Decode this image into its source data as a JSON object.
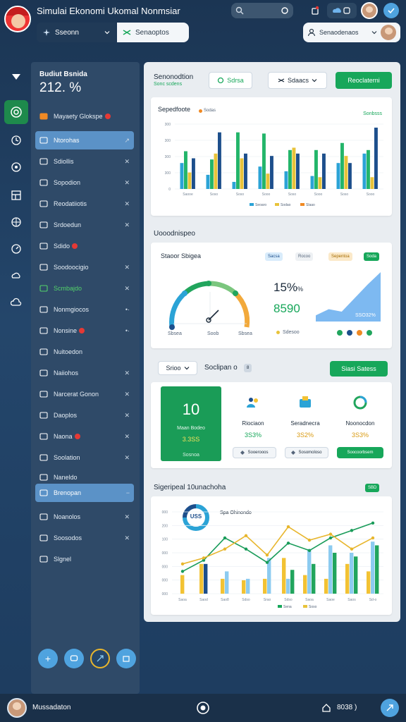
{
  "app": {
    "title": "Simulai Ekonomi Ukomal Nonmsiar",
    "search_placeholder": "",
    "user_name": "Mussadaton",
    "bottom_right_label": "8038 )"
  },
  "subtoolbar": {
    "left_label": "Sseonn",
    "mid_label": "Senaoptos",
    "right_label": "Senaodenaos"
  },
  "rail": {
    "items": [
      "home-icon",
      "target-icon",
      "clock-icon",
      "compass-icon",
      "grid-icon",
      "globe-icon",
      "gauge-icon",
      "cloud-shield-icon",
      "cloud-icon"
    ]
  },
  "sidebar": {
    "head_title": "Budiut Bsnida",
    "head_value": "212. %",
    "items": [
      {
        "label": "Mayaety Glokspe",
        "badge": true,
        "chev": "",
        "state": ""
      },
      {
        "label": "Ntorohas",
        "badge": false,
        "chev": "↗",
        "state": "active"
      },
      {
        "label": "Sdiollis",
        "badge": false,
        "chev": "✕",
        "state": ""
      },
      {
        "label": "Sopodion",
        "badge": false,
        "chev": "✕",
        "state": ""
      },
      {
        "label": "Reodatiiotis",
        "badge": false,
        "chev": "✕",
        "state": ""
      },
      {
        "label": "Srdoedun",
        "badge": false,
        "chev": "✕",
        "state": ""
      },
      {
        "label": "Sdido",
        "badge": true,
        "chev": "",
        "state": ""
      },
      {
        "label": "Soodoocigio",
        "badge": false,
        "chev": "✕",
        "state": ""
      },
      {
        "label": "Scmbajdo",
        "badge": false,
        "chev": "✕",
        "state": "green"
      },
      {
        "label": "Nonmgiocos",
        "badge": false,
        "chev": "•·",
        "state": ""
      },
      {
        "label": "Nonsine",
        "badge": true,
        "chev": "•·",
        "state": ""
      },
      {
        "label": "Nuitoedon",
        "badge": false,
        "chev": "",
        "state": ""
      },
      {
        "label": "Naiiohos",
        "badge": false,
        "chev": "✕",
        "state": ""
      },
      {
        "label": "Narcerat Gonon",
        "badge": false,
        "chev": "✕",
        "state": ""
      },
      {
        "label": "Daoplos",
        "badge": false,
        "chev": "✕",
        "state": ""
      },
      {
        "label": "Naona",
        "badge": true,
        "chev": "✕",
        "state": ""
      },
      {
        "label": "Soolation",
        "badge": false,
        "chev": "✕",
        "state": ""
      },
      {
        "label": "Naneldo",
        "badge": false,
        "chev": "",
        "state": ""
      },
      {
        "label": "Brenopan",
        "badge": false,
        "chev": "−",
        "state": "active"
      },
      {
        "label": "Noanolos",
        "badge": false,
        "chev": "✕",
        "state": ""
      },
      {
        "label": "Soosodos",
        "badge": false,
        "chev": "✕",
        "state": ""
      },
      {
        "label": "Slgnel",
        "badge": false,
        "chev": "",
        "state": ""
      }
    ]
  },
  "main": {
    "section1": {
      "title": "Senonodtion",
      "subtitle": "Sonc scdens",
      "btn_secondary": "Sdrsa",
      "dropdown": "Sdaacs",
      "btn_primary": "Reoclaterni"
    },
    "chart1": {
      "title": "Sepedfoote",
      "legend": "Sodas",
      "corner": "Sonbsss",
      "footer_legend": [
        "Seoaro",
        "Sodao",
        "Slaao"
      ]
    },
    "section2": {
      "title": "Uooodnispeo"
    },
    "gauge_card": {
      "title": "Staoor Sbigea",
      "tags": [
        "Sacsa",
        "Rocoo",
        "Sepentoa",
        "Soda"
      ],
      "percent": "15%",
      "percent_suffix": "%",
      "value": "8590",
      "area_label": "SSO32%",
      "legend_text": "Sdesoo",
      "gauge_left_label": "Sbsea",
      "gauge_right_label": "Sbsea",
      "gauge_mid_label": "Soob"
    },
    "section3": {
      "dropdown": "Srioo",
      "title": "Soclipan o",
      "badge": "8",
      "btn_primary": "Siasi Satess"
    },
    "kpis": {
      "main_value": "10",
      "main_label": "Maan Bodeo",
      "main_sub": "3.3SS",
      "main_foot": "Sosnoa",
      "items": [
        {
          "title": "Riociaon",
          "value": "3S3%",
          "btn": "Sooerooos"
        },
        {
          "title": "Seradnecra",
          "value": "3S2%",
          "btn": "Sosomoloso"
        },
        {
          "title": "Noonocdon",
          "value": "3S3%",
          "btn": "Soocoorbsem"
        }
      ]
    },
    "chart2": {
      "title": "Sigeripeal 10unachoha",
      "badge": "SBD",
      "donut_value": "USS",
      "inset_title": "Spa Ohinondo",
      "footer_legend": [
        "Sena",
        "Soso"
      ]
    }
  },
  "chart_data": [
    {
      "type": "bar",
      "title": "Sepedfoote",
      "categories": [
        "Saooe",
        "Soso",
        "Soso",
        "Sooo",
        "Soso",
        "Sooo",
        "Soso",
        "Sooo"
      ],
      "yticks": [
        "300",
        "300",
        "300",
        "300",
        "0"
      ],
      "series": [
        {
          "values": [
            44,
            24,
            12,
            38,
            30,
            22,
            44,
            60
          ],
          "color": "#2ba3d6"
        },
        {
          "values": [
            64,
            50,
            96,
            94,
            66,
            66,
            78,
            66
          ],
          "color": "#23b56a"
        },
        {
          "values": [
            28,
            60,
            52,
            26,
            70,
            20,
            56,
            20
          ],
          "color": "#e8c33a"
        },
        {
          "values": [
            52,
            96,
            60,
            56,
            60,
            60,
            44,
            104
          ],
          "color": "#1d4f8c"
        }
      ]
    },
    {
      "type": "line",
      "title": "Sigeripeal 10unachoha",
      "categories": [
        "Saoa",
        "Saod",
        "Sao8",
        "Sdso",
        "Srao",
        "Sdso",
        "Saoa",
        "Saoe",
        "Saos",
        "Sd-o"
      ],
      "yticks": [
        "000",
        "200",
        "100",
        "000",
        "000",
        "000",
        "000"
      ],
      "series": [
        {
          "name": "",
          "values": [
            30,
            45,
            75,
            60,
            42,
            68,
            58,
            75,
            85,
            95
          ],
          "color": "#1a9c5a",
          "kind": "line"
        },
        {
          "name": "",
          "values": [
            40,
            48,
            60,
            78,
            52,
            90,
            72,
            80,
            60,
            75
          ],
          "color": "#e8b62d",
          "kind": "line"
        },
        {
          "name": "",
          "values": [
            25,
            40,
            20,
            18,
            20,
            48,
            25,
            20,
            40,
            30
          ],
          "color": "#f2c233",
          "kind": "bar"
        },
        {
          "name": "",
          "values": [
            0,
            40,
            0,
            0,
            0,
            0,
            0,
            0,
            0,
            0
          ],
          "color": "#1d4f8c",
          "kind": "bar"
        },
        {
          "name": "",
          "values": [
            0,
            0,
            30,
            20,
            48,
            20,
            60,
            65,
            55,
            70
          ],
          "color": "#8ccbf0",
          "kind": "bar"
        },
        {
          "name": "",
          "values": [
            0,
            0,
            0,
            0,
            0,
            32,
            40,
            55,
            50,
            65
          ],
          "color": "#21a55d",
          "kind": "bar"
        }
      ]
    },
    {
      "type": "area",
      "title": "",
      "values": [
        10,
        20,
        16,
        38,
        60,
        80
      ],
      "color": "#7db9f1"
    }
  ],
  "colors": {
    "accent_green": "#17a75a",
    "accent_blue": "#5b92c7",
    "sidebar": "#2f4a68",
    "badge_red": "#e53935"
  }
}
